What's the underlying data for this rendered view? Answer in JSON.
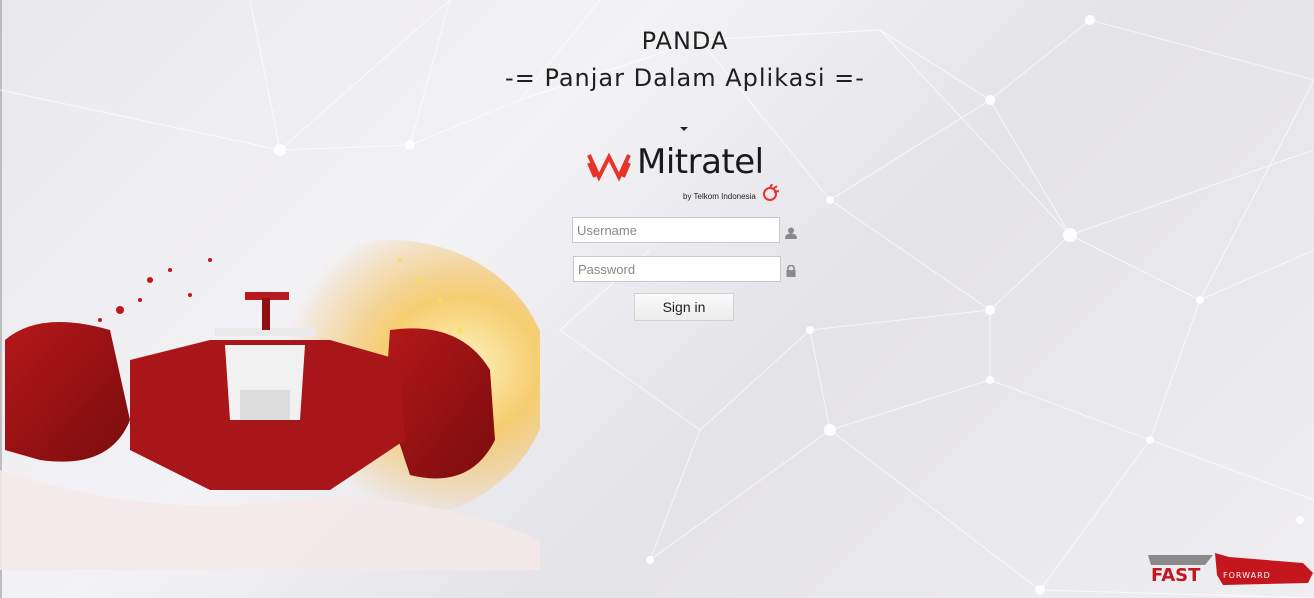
{
  "header": {
    "title": "PANDA",
    "subtitle": "-= Panjar Dalam Aplikasi =-"
  },
  "logo": {
    "wordmark": "Mitratel",
    "byline": "by Telkom Indonesia",
    "mark_icon": "mitratel-m-icon",
    "telkom_icon": "telkom-icon",
    "brand_color": "#e8332a"
  },
  "login": {
    "username_placeholder": "Username",
    "username_value": "",
    "password_placeholder": "Password",
    "password_value": "",
    "username_icon": "user-icon",
    "password_icon": "lock-icon",
    "signin_label": "Sign in"
  },
  "footer_logo": {
    "text_main": "FAST",
    "text_sub": "FORWARD",
    "icon": "fast-forward-car-logo"
  },
  "colors": {
    "background": "#eceaee",
    "accent_red": "#c4161c"
  }
}
